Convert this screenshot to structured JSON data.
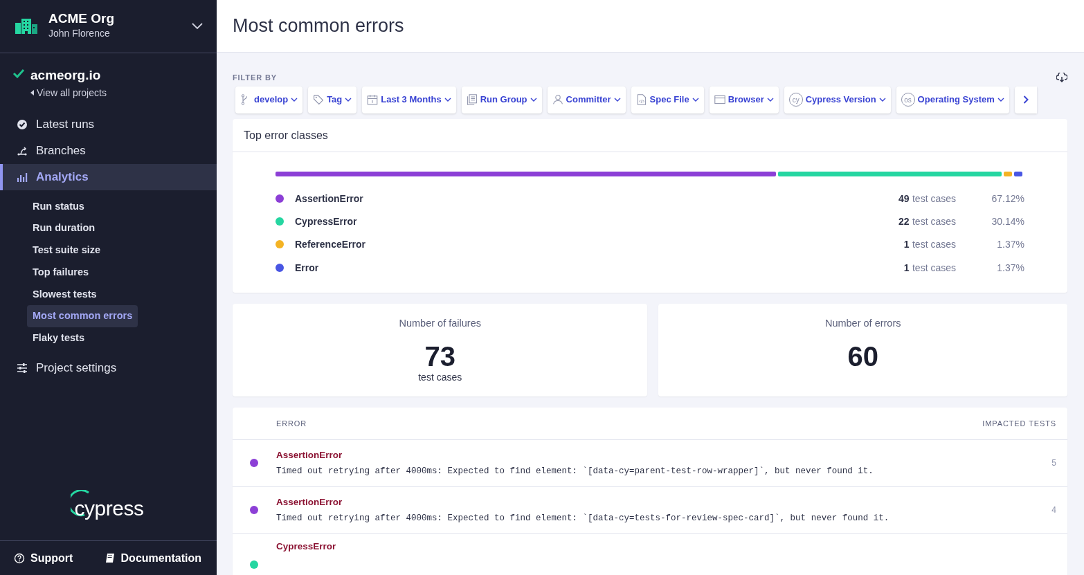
{
  "org": {
    "name": "ACME Org",
    "user": "John Florence"
  },
  "project": {
    "name": "acmeorg.io",
    "back_link": "View all projects"
  },
  "nav": [
    {
      "label": "Latest runs",
      "kind": "check-circle",
      "selected": false
    },
    {
      "label": "Branches",
      "kind": "branch",
      "selected": false
    },
    {
      "label": "Analytics",
      "kind": "bars",
      "selected": true,
      "children": [
        {
          "label": "Run status",
          "selected": false
        },
        {
          "label": "Run duration",
          "selected": false
        },
        {
          "label": "Test suite size",
          "selected": false
        },
        {
          "label": "Top failures",
          "selected": false
        },
        {
          "label": "Slowest tests",
          "selected": false
        },
        {
          "label": "Most common errors",
          "selected": true
        },
        {
          "label": "Flaky tests",
          "selected": false
        }
      ]
    },
    {
      "label": "Project settings",
      "kind": "sliders",
      "selected": false
    }
  ],
  "logo_text": "cypress",
  "footer_links": [
    {
      "label": "Support",
      "kind": "help"
    },
    {
      "label": "Documentation",
      "kind": "book"
    }
  ],
  "page_title": "Most common errors",
  "filter_label": "FILTER BY",
  "filters": [
    {
      "label": "develop",
      "kind": "branch"
    },
    {
      "label": "Tag",
      "kind": "tag"
    },
    {
      "label": "Last 3 Months",
      "kind": "calendar"
    },
    {
      "label": "Run Group",
      "kind": "docs"
    },
    {
      "label": "Committer",
      "kind": "person"
    },
    {
      "label": "Spec File",
      "kind": "file"
    },
    {
      "label": "Browser",
      "kind": "window"
    },
    {
      "label": "Cypress Version",
      "kind": "circle-text",
      "icon_text": "cy"
    },
    {
      "label": "Operating System",
      "kind": "circle-text",
      "icon_text": "os"
    }
  ],
  "top_errors": {
    "title": "Top error classes",
    "classes": [
      {
        "name": "AssertionError",
        "color": "#8c3fd6",
        "count": "49",
        "unit": "test cases",
        "percent": "67.12%"
      },
      {
        "name": "CypressError",
        "color": "#25d6a1",
        "count": "22",
        "unit": "test cases",
        "percent": "30.14%"
      },
      {
        "name": "ReferenceError",
        "color": "#f4b324",
        "count": "1",
        "unit": "test cases",
        "percent": "1.37%"
      },
      {
        "name": "Error",
        "color": "#4956e3",
        "count": "1",
        "unit": "test cases",
        "percent": "1.37%"
      }
    ]
  },
  "stats": [
    {
      "title": "Number of failures",
      "value": "73",
      "caption": "test cases"
    },
    {
      "title": "Number of errors",
      "value": "60"
    }
  ],
  "table": {
    "columns": [
      "ERROR",
      "IMPACTED TESTS"
    ],
    "rows": [
      {
        "name": "AssertionError",
        "color": "#8c3fd6",
        "message": "Timed out retrying after 4000ms: Expected to find element: `[data-cy=parent-test-row-wrapper]`, but never found it.",
        "count": "5"
      },
      {
        "name": "AssertionError",
        "color": "#8c3fd6",
        "message": "Timed out retrying after 4000ms: Expected to find element: `[data-cy=tests-for-review-spec-card]`, but never found it.",
        "count": "4"
      },
      {
        "name": "CypressError",
        "color": "#25d6a1"
      }
    ]
  }
}
